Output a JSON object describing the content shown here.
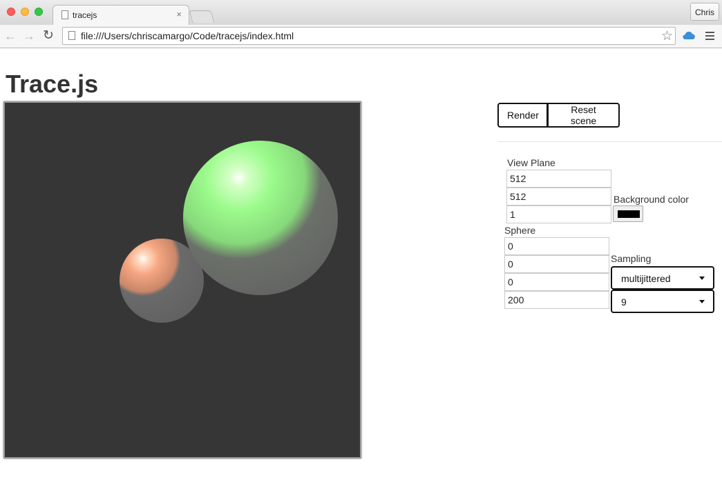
{
  "browser": {
    "tab_title": "tracejs",
    "tab_close": "×",
    "profile_name": "Chris",
    "url": "file:///Users/chriscamargo/Code/tracejs/index.html",
    "icons": [
      "back-arrow-icon",
      "forward-arrow-icon",
      "reload-icon",
      "document-icon",
      "star-icon",
      "cloud-icon",
      "menu-icon"
    ]
  },
  "page": {
    "title": "Trace.js",
    "buttons": {
      "render": "Render",
      "reset": "Reset scene"
    },
    "view_plane": {
      "label": "View Plane",
      "values": [
        "512",
        "512",
        "1"
      ]
    },
    "background_color": {
      "label": "Background color",
      "value": "#000000"
    },
    "sphere": {
      "label": "Sphere",
      "values": [
        "0",
        "0",
        "0",
        "200"
      ]
    },
    "sampling": {
      "label": "Sampling",
      "method": "multijittered",
      "samples": "9"
    }
  },
  "scene": {
    "background": "#363636",
    "spheres": [
      {
        "color_light": "#ffc29a",
        "color_mid": "#e58f6a",
        "shadow": "#656565"
      },
      {
        "color_light": "#c6ffb4",
        "color_mid": "#93f68a",
        "shadow": "#656565"
      }
    ]
  }
}
